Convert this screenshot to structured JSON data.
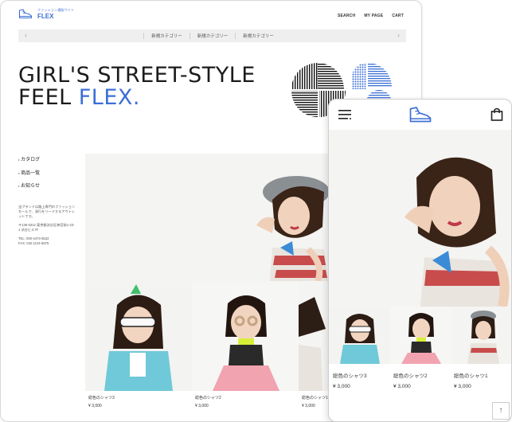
{
  "desktop": {
    "logo": {
      "tagline": "ファッション通販サイト",
      "name": "FLEX"
    },
    "nav": [
      "SEARCH",
      "MY PAGE",
      "CART"
    ],
    "categories": [
      "新規カテゴリー",
      "新規カテゴリー",
      "新規カテゴリー"
    ],
    "headline_line1": "GIRL'S STREET-STYLE",
    "headline_line2_prefix": "FEEL ",
    "headline_accent": "FLEX.",
    "left_menu": [
      "カタログ",
      "商品一覧",
      "お知らせ"
    ],
    "about": {
      "description": "当ブランドは路上専門のファッションモールで、流行をリードするアウトレットです。",
      "address": "〒135-0312 東京都渋谷区神宮前1-23-1 渋谷ビル7F",
      "tel": "TEL: 000-4474-5532",
      "fax": "FAX: 042-1124-5675"
    },
    "products": [
      {
        "name": "総色のシャツ3",
        "price": "¥ 3,000"
      },
      {
        "name": "総色のシャツ2",
        "price": "¥ 3,000"
      },
      {
        "name": "総色のシャツ1",
        "price": "¥ 3,000"
      }
    ]
  },
  "mobile": {
    "products": [
      {
        "name": "総色のシャツ3",
        "price": "¥ 3,000"
      },
      {
        "name": "総色のシャツ2",
        "price": "¥ 3,000"
      },
      {
        "name": "総色のシャツ1",
        "price": "¥ 3,000"
      }
    ],
    "totop_glyph": "↑"
  },
  "colors": {
    "accent": "#3c6fd6"
  },
  "icons": [
    "sneaker-logo-icon",
    "hamburger-menu-icon",
    "shopping-bag-icon",
    "chevron-left-icon",
    "chevron-right-icon",
    "arrow-up-icon"
  ]
}
